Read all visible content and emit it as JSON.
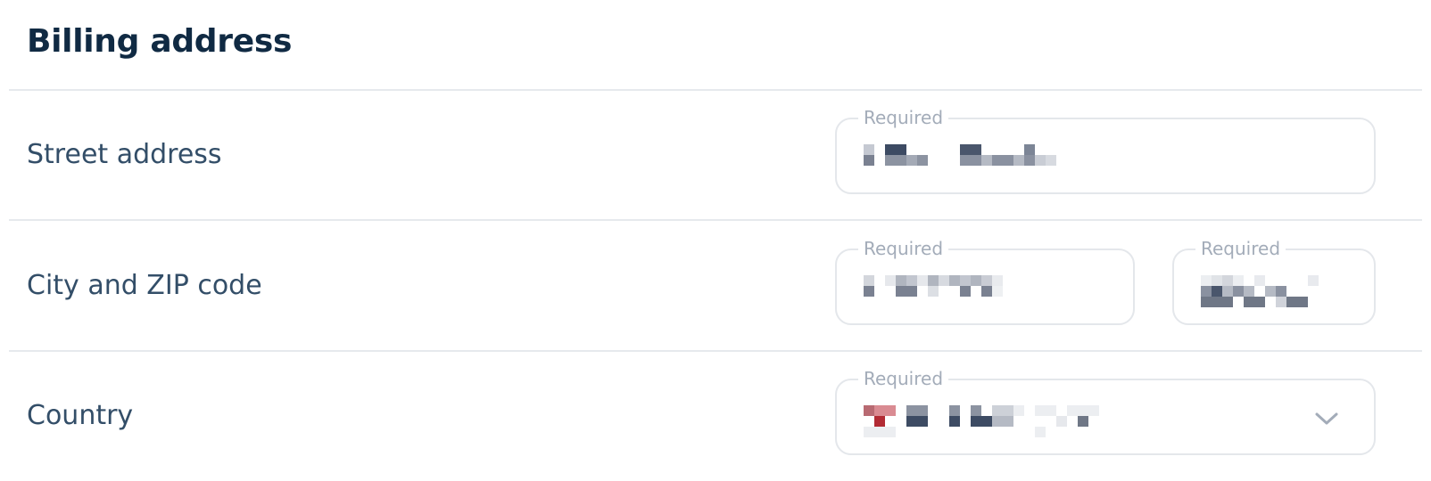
{
  "section": {
    "title": "Billing address"
  },
  "rows": {
    "street": {
      "label": "Street address",
      "field_legend": "Required"
    },
    "city_zip": {
      "label": "City and ZIP code",
      "city_legend": "Required",
      "zip_legend": "Required"
    },
    "country": {
      "label": "Country",
      "field_legend": "Required",
      "dropdown_icon": "chevron-down-icon"
    }
  },
  "colors": {
    "title": "#102a43",
    "label": "#334e68",
    "legend": "#a3acb9",
    "border": "#e4e7eb",
    "divider": "#e6e9ed"
  }
}
